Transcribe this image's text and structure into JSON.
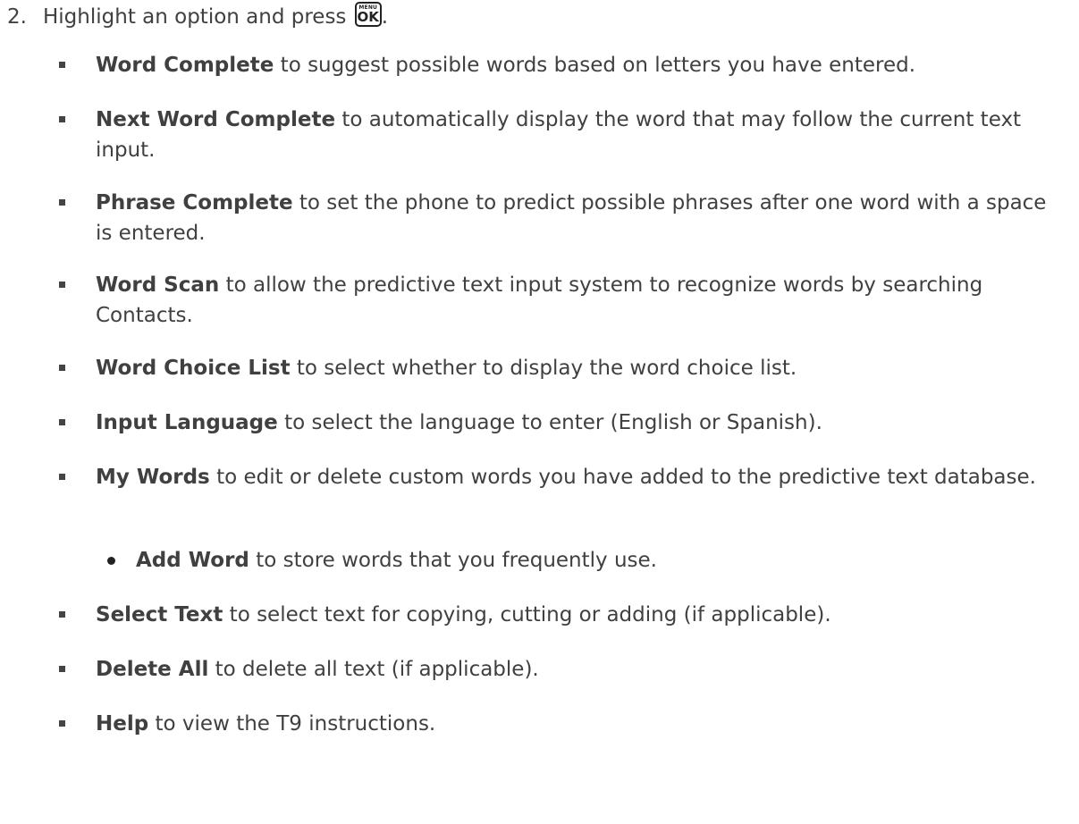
{
  "step": {
    "number": "2.",
    "text_before": "Highlight an option and press",
    "key_icon": "menu-ok-key-icon",
    "key_top": "MENU",
    "key_bottom": "OK",
    "text_after": "."
  },
  "options": [
    {
      "term": "Word Complete",
      "desc": "to suggest possible words based on letters you have entered.",
      "level": 1
    },
    {
      "term": "Next Word Complete",
      "desc": "to automatically display the word that may follow the current text input.",
      "level": 1
    },
    {
      "term": "Phrase Complete",
      "desc": "to set the phone to predict possible phrases after one word with a space is entered.",
      "level": 1
    },
    {
      "term": "Word Scan",
      "desc": "to allow the predictive text input system to recognize words by searching Contacts.",
      "level": 1
    },
    {
      "term": "Word Choice List",
      "desc": "to select whether to display the word choice list.",
      "level": 1
    },
    {
      "term": "Input Language",
      "desc": "to select the language to enter (English or Spanish).",
      "level": 1
    },
    {
      "term": "My Words",
      "desc": "to edit or delete custom words you have added to the predictive text database.",
      "level": 1
    },
    {
      "term": "Add Word",
      "desc": "to store words that you frequently use.",
      "level": 2
    },
    {
      "term": "Select Text",
      "desc": "to select text for copying, cutting or adding (if applicable).",
      "level": 1
    },
    {
      "term": "Delete All",
      "desc": "to delete all text (if applicable).",
      "level": 1
    },
    {
      "term": "Help",
      "desc": "to view the T9 instructions.",
      "level": 1
    }
  ]
}
